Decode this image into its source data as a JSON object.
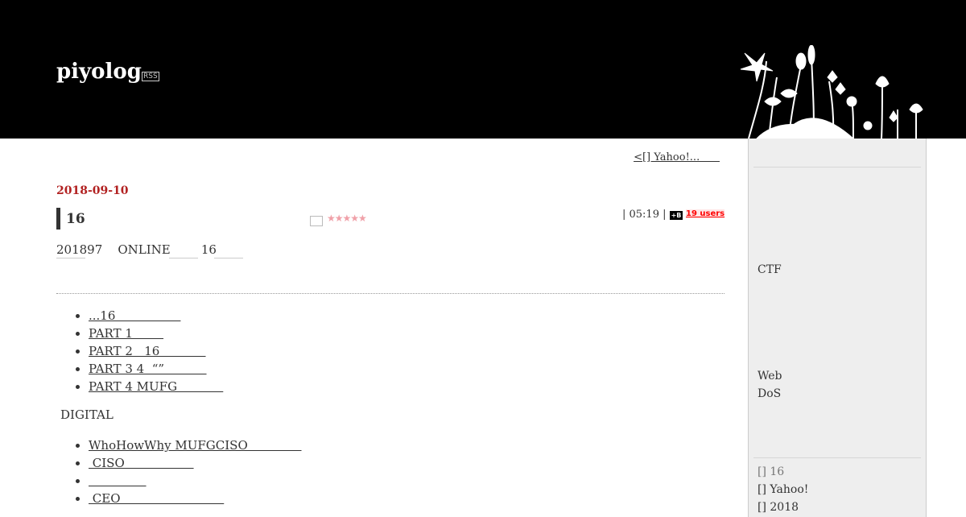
{
  "header": {
    "blog_title": "piyolog",
    "rss_label": "RSS"
  },
  "pager": {
    "prev_label": "<[] Yahoo!...      "
  },
  "entry": {
    "date": "2018-09-10",
    "title": "16",
    "meta_time": "| 05:19 |",
    "hatena_icon": "+B",
    "bookmark_users": "19 users",
    "stars": "★★★★★",
    "intro": "201897    ONLINE        16"
  },
  "toc": {
    "items": [
      "...16                 ",
      "PART 1        ",
      "PART 2   16            ",
      "PART 3 4  “”           ",
      "PART 4 MUFG            "
    ]
  },
  "section": {
    "label": "DIGITAL",
    "items": [
      "WhoHowWhy MUFGCISO              ",
      " CISO                  ",
      "               ",
      " CEO                           "
    ]
  },
  "sidebar": {
    "ctf_label": "CTF",
    "web_label": "Web",
    "dos_label": "DoS",
    "recent_links": [
      "[] 16",
      "[] Yahoo!",
      "[] 2018"
    ]
  },
  "icons": {
    "flowers": "flower-silhouette-illustration",
    "star_image": "image-icon"
  },
  "colors": {
    "header_bg": "#000000",
    "date_red": "#b22222",
    "bookmark_red": "#ff0000",
    "sidebar_bg": "#eeeeee"
  }
}
